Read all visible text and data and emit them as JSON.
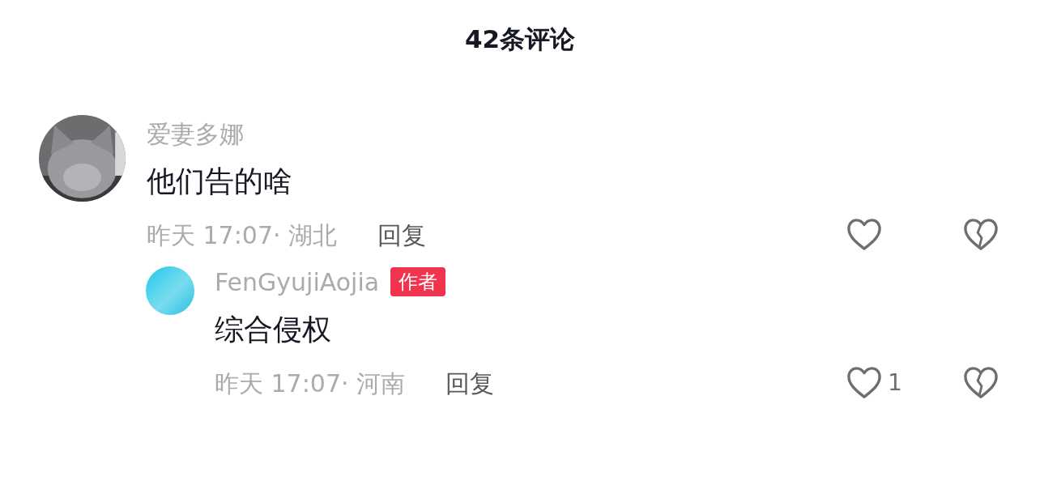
{
  "header": {
    "title": "42条评论"
  },
  "comments": [
    {
      "user": "爱妻多娜",
      "text": "他们告的啥",
      "meta": "昨天 17:07· 湖北",
      "reply": "回复",
      "replies": [
        {
          "avatar": {
            "kind": "gradient"
          },
          "user": "FenGyujiAojia",
          "badge": "作者",
          "text": "综合侵权",
          "meta": "昨天 17:07· 河南",
          "reply": "回复",
          "likes": "1"
        }
      ]
    }
  ]
}
